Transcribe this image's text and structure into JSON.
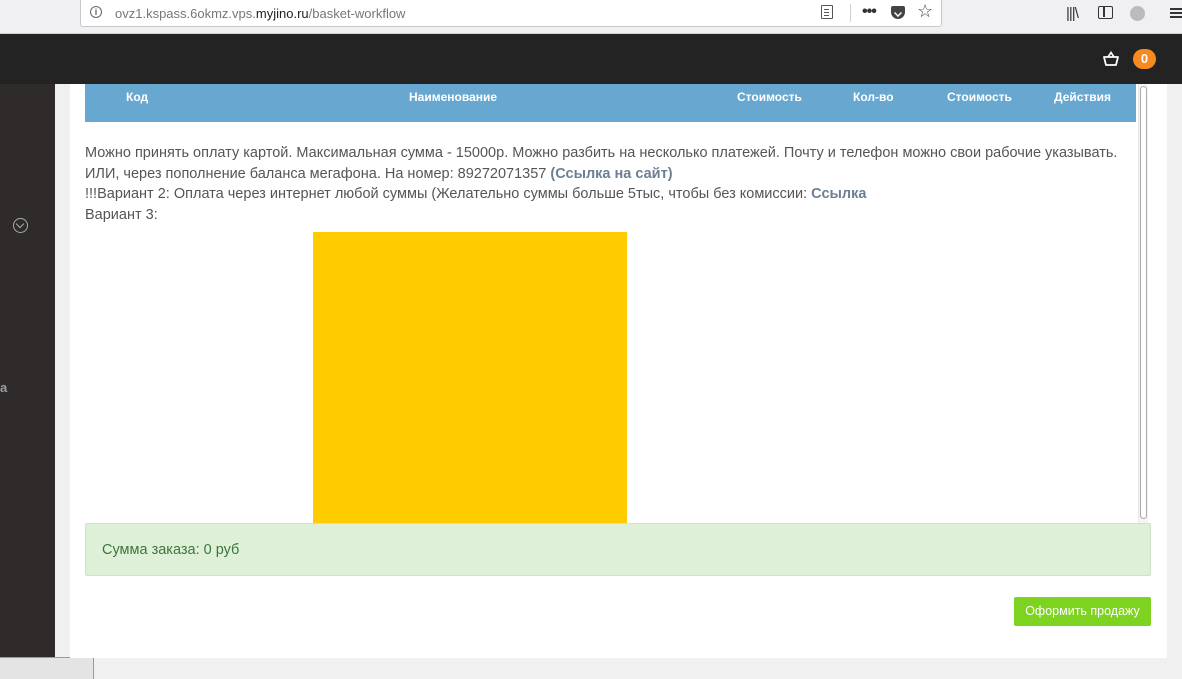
{
  "browser": {
    "url_prefix": "ovz1.kspass.6okmz.vps.",
    "url_domain": "myjino.ru",
    "url_path": "/basket-workflow"
  },
  "header": {
    "cart_count": "0"
  },
  "sidebar": {
    "partial_label": "а"
  },
  "table": {
    "columns": [
      "Код",
      "Наименование",
      "Стоимость",
      "Кол-во",
      "Стоимость",
      "Действия"
    ]
  },
  "notes": {
    "line1": "Можно принять оплату картой. Максимальная сумма - 15000р. Можно разбить на несколько платежей. Почту и телефон можно свои рабочие указывать.",
    "line2_text": "ИЛИ, через пополнение баланса мегафона. На номер: 89272071357 ",
    "line2_link": "(Ссылка на сайт)",
    "line3_text": "!!!Вариант 2: Оплата через интернет любой суммы (Желательно суммы больше 5тыс, чтобы без комиссии: ",
    "line3_link": "Ссылка",
    "line4_text": "Вариант 3:"
  },
  "summary": {
    "total_label": "Сумма заказа: 0 руб"
  },
  "actions": {
    "checkout_label": "Оформить продажу"
  },
  "colors": {
    "header_bg": "#232323",
    "table_head_bg": "#68a7cf",
    "badge": "#f58a1f",
    "success_bg": "#dff0d8",
    "checkout_button": "#7ed321",
    "image_block": "#ffcc00"
  }
}
